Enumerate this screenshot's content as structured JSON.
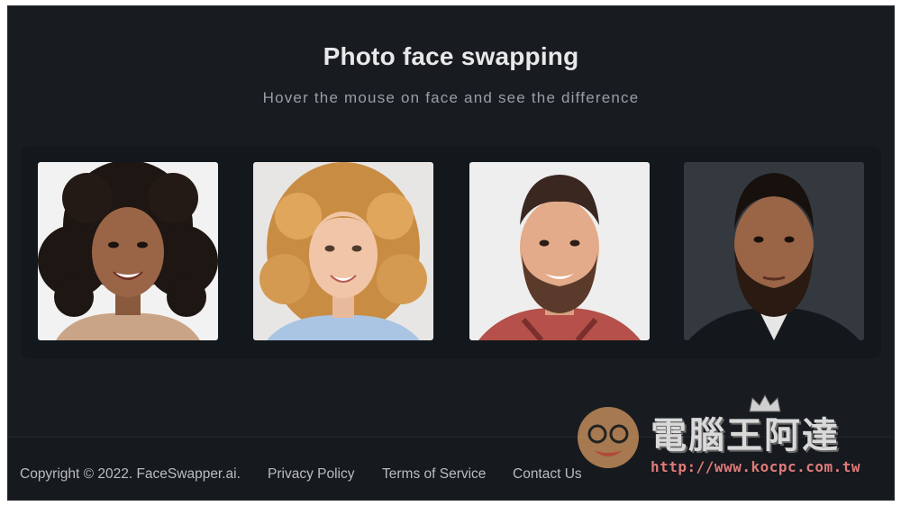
{
  "hero": {
    "title": "Photo face swapping",
    "subtitle": "Hover the mouse on face and see the difference"
  },
  "gallery": {
    "faces": [
      {
        "icon": "curly-hair-woman-portrait"
      },
      {
        "icon": "blonde-woman-portrait"
      },
      {
        "icon": "bearded-man-portrait"
      },
      {
        "icon": "bearded-man-dark-background-portrait"
      }
    ]
  },
  "footer": {
    "copyright": "Copyright © 2022. FaceSwapper.ai.",
    "privacy": "Privacy Policy",
    "terms": "Terms of Service",
    "contact": "Contact Us"
  },
  "watermark": {
    "name": "電腦王阿達",
    "url": "http://www.kocpc.com.tw"
  },
  "colors": {
    "background": "#181b20",
    "gallery_panel": "#12181c",
    "footer": "#16191d"
  }
}
